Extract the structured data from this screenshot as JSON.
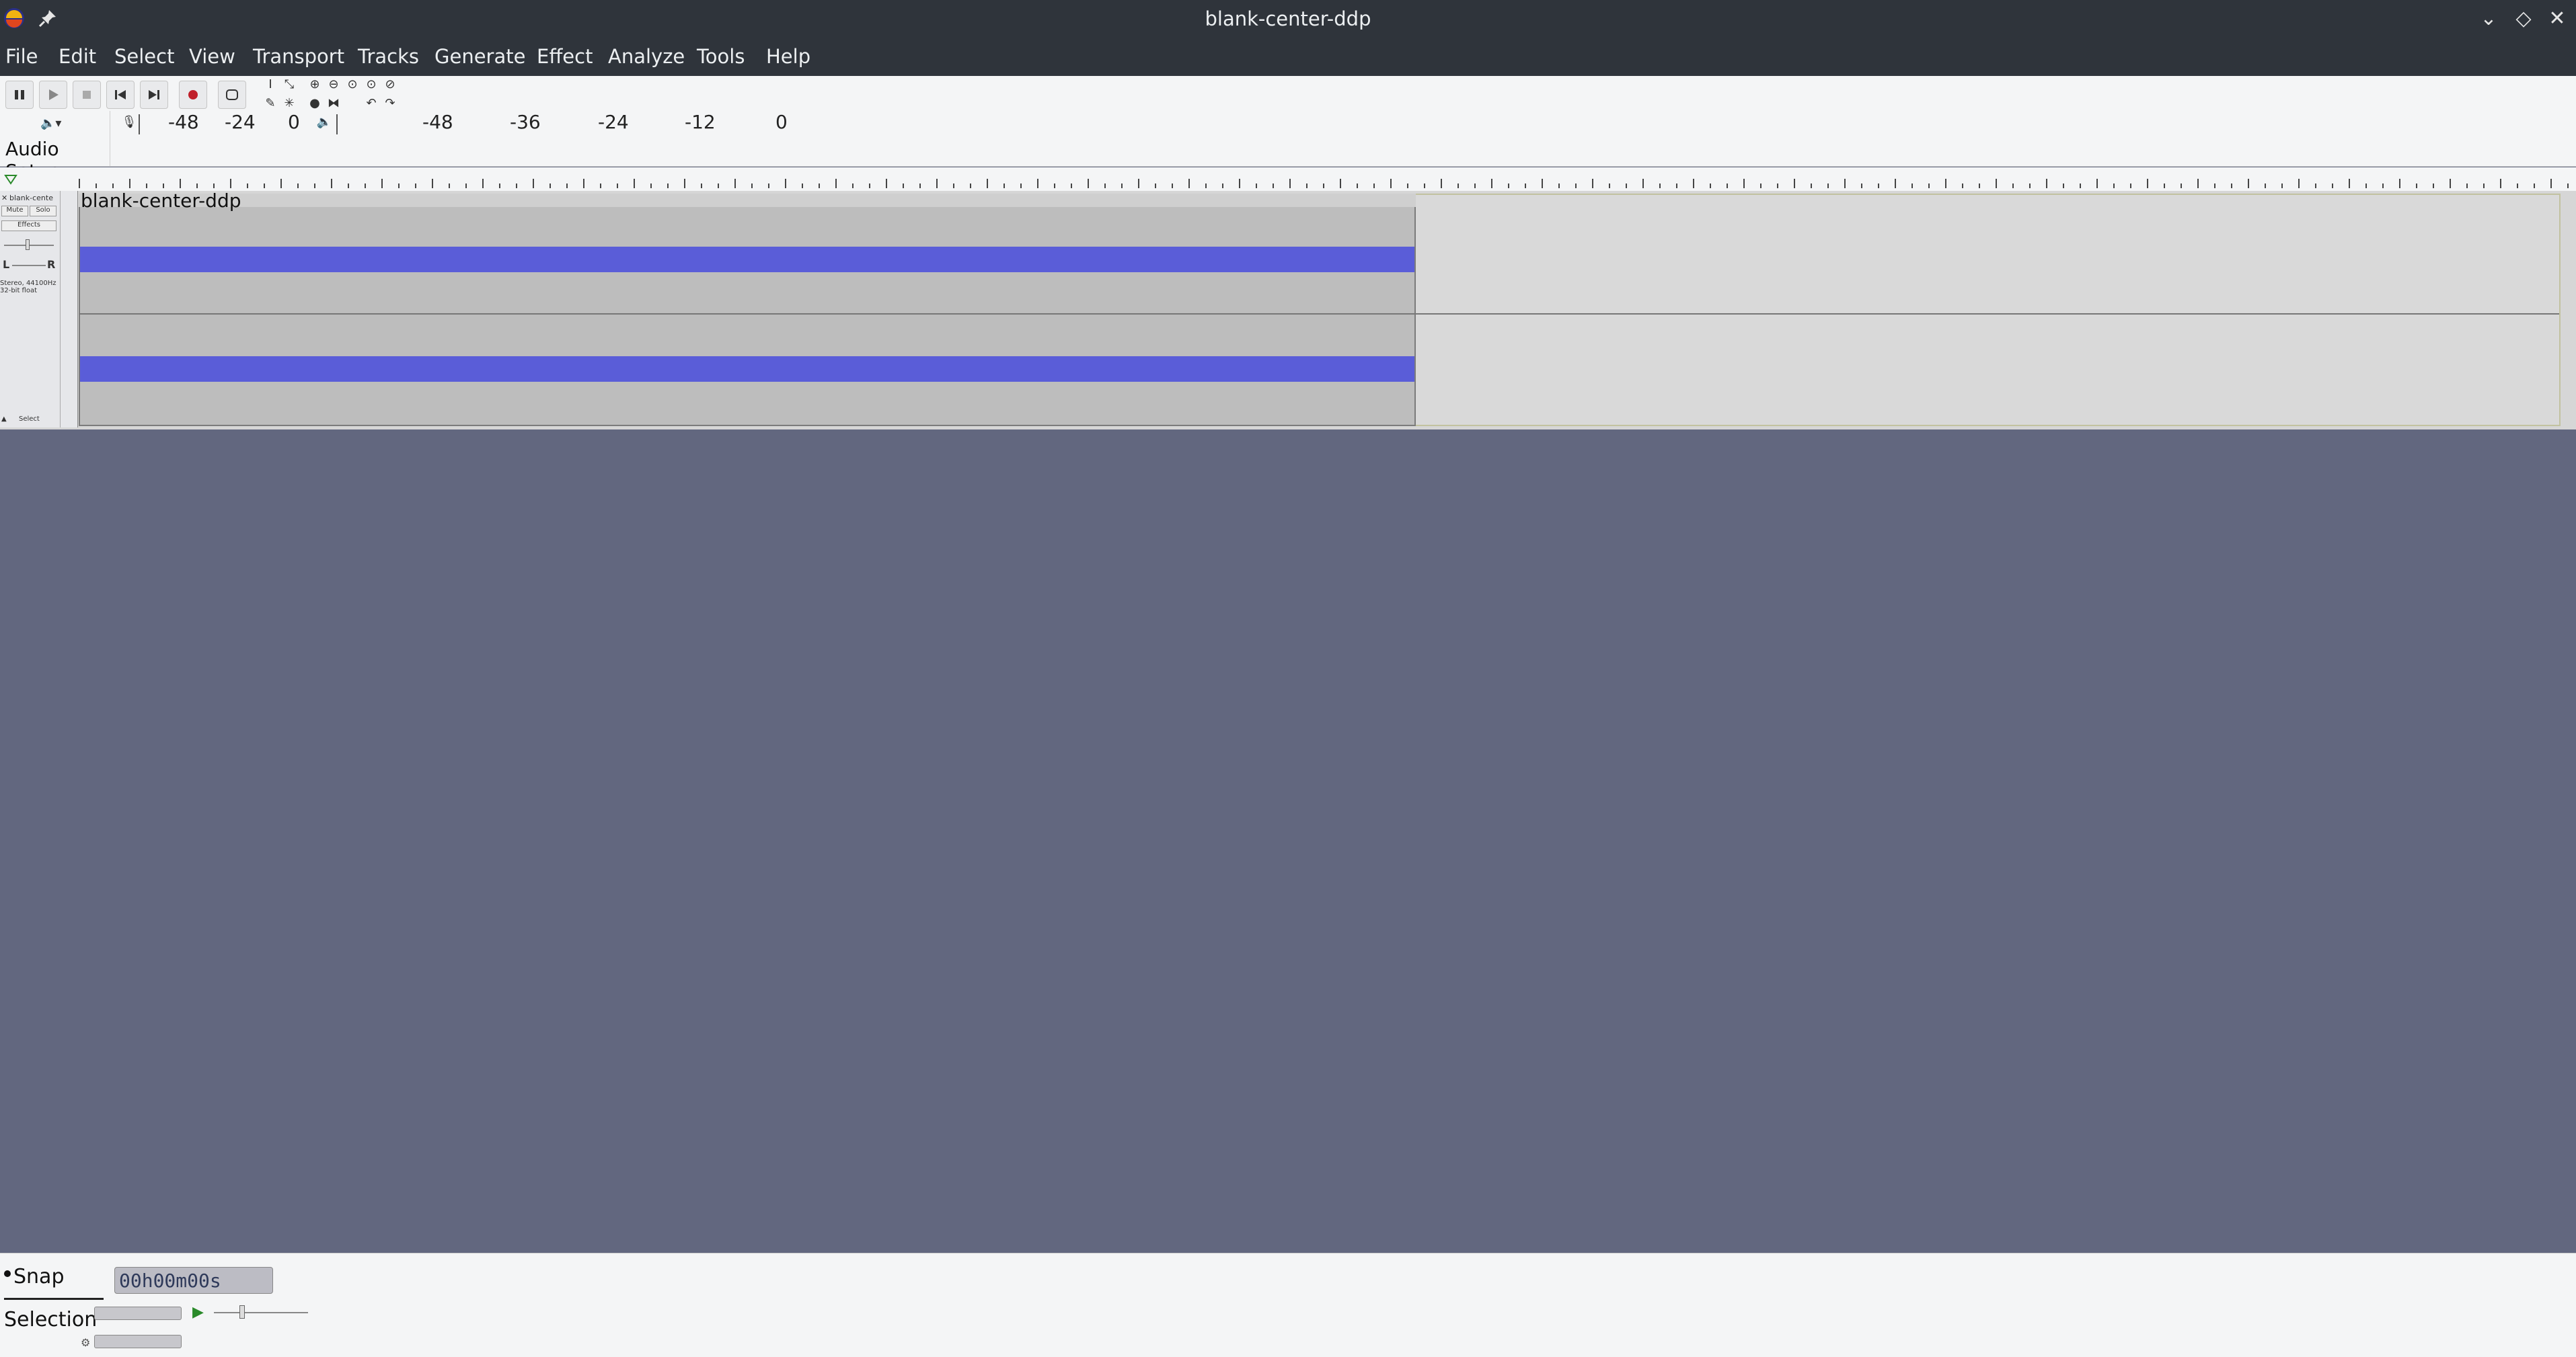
{
  "window": {
    "title": "blank-center-ddp"
  },
  "menu": [
    "File",
    "Edit",
    "Select",
    "View",
    "Transport",
    "Tracks",
    "Generate",
    "Effect",
    "Analyze",
    "Tools",
    "Help"
  ],
  "toolbar": {
    "audio_setup_label": "Audio Setup",
    "record_meter_ticks": [
      "-48",
      "-24",
      "0"
    ],
    "play_meter_ticks": [
      "-48",
      "-36",
      "-24",
      "-12",
      "0"
    ]
  },
  "track": {
    "name": "blank-center-ddp",
    "control_name": "blank-cente",
    "mute_label": "Mute",
    "solo_label": "Solo",
    "effects_label": "Effects",
    "pan_left": "L",
    "pan_right": "R",
    "info": "Stereo, 44100Hz 32-bit float",
    "select_label": "Select"
  },
  "bottom": {
    "snap_label": "Snap",
    "selection_label": "Selection",
    "time_value": "00h00m00s"
  },
  "colors": {
    "background": "#62677f",
    "titlebar": "#2f343b",
    "waveform": "#5a5dd8",
    "clip": "#bdbdbd"
  }
}
